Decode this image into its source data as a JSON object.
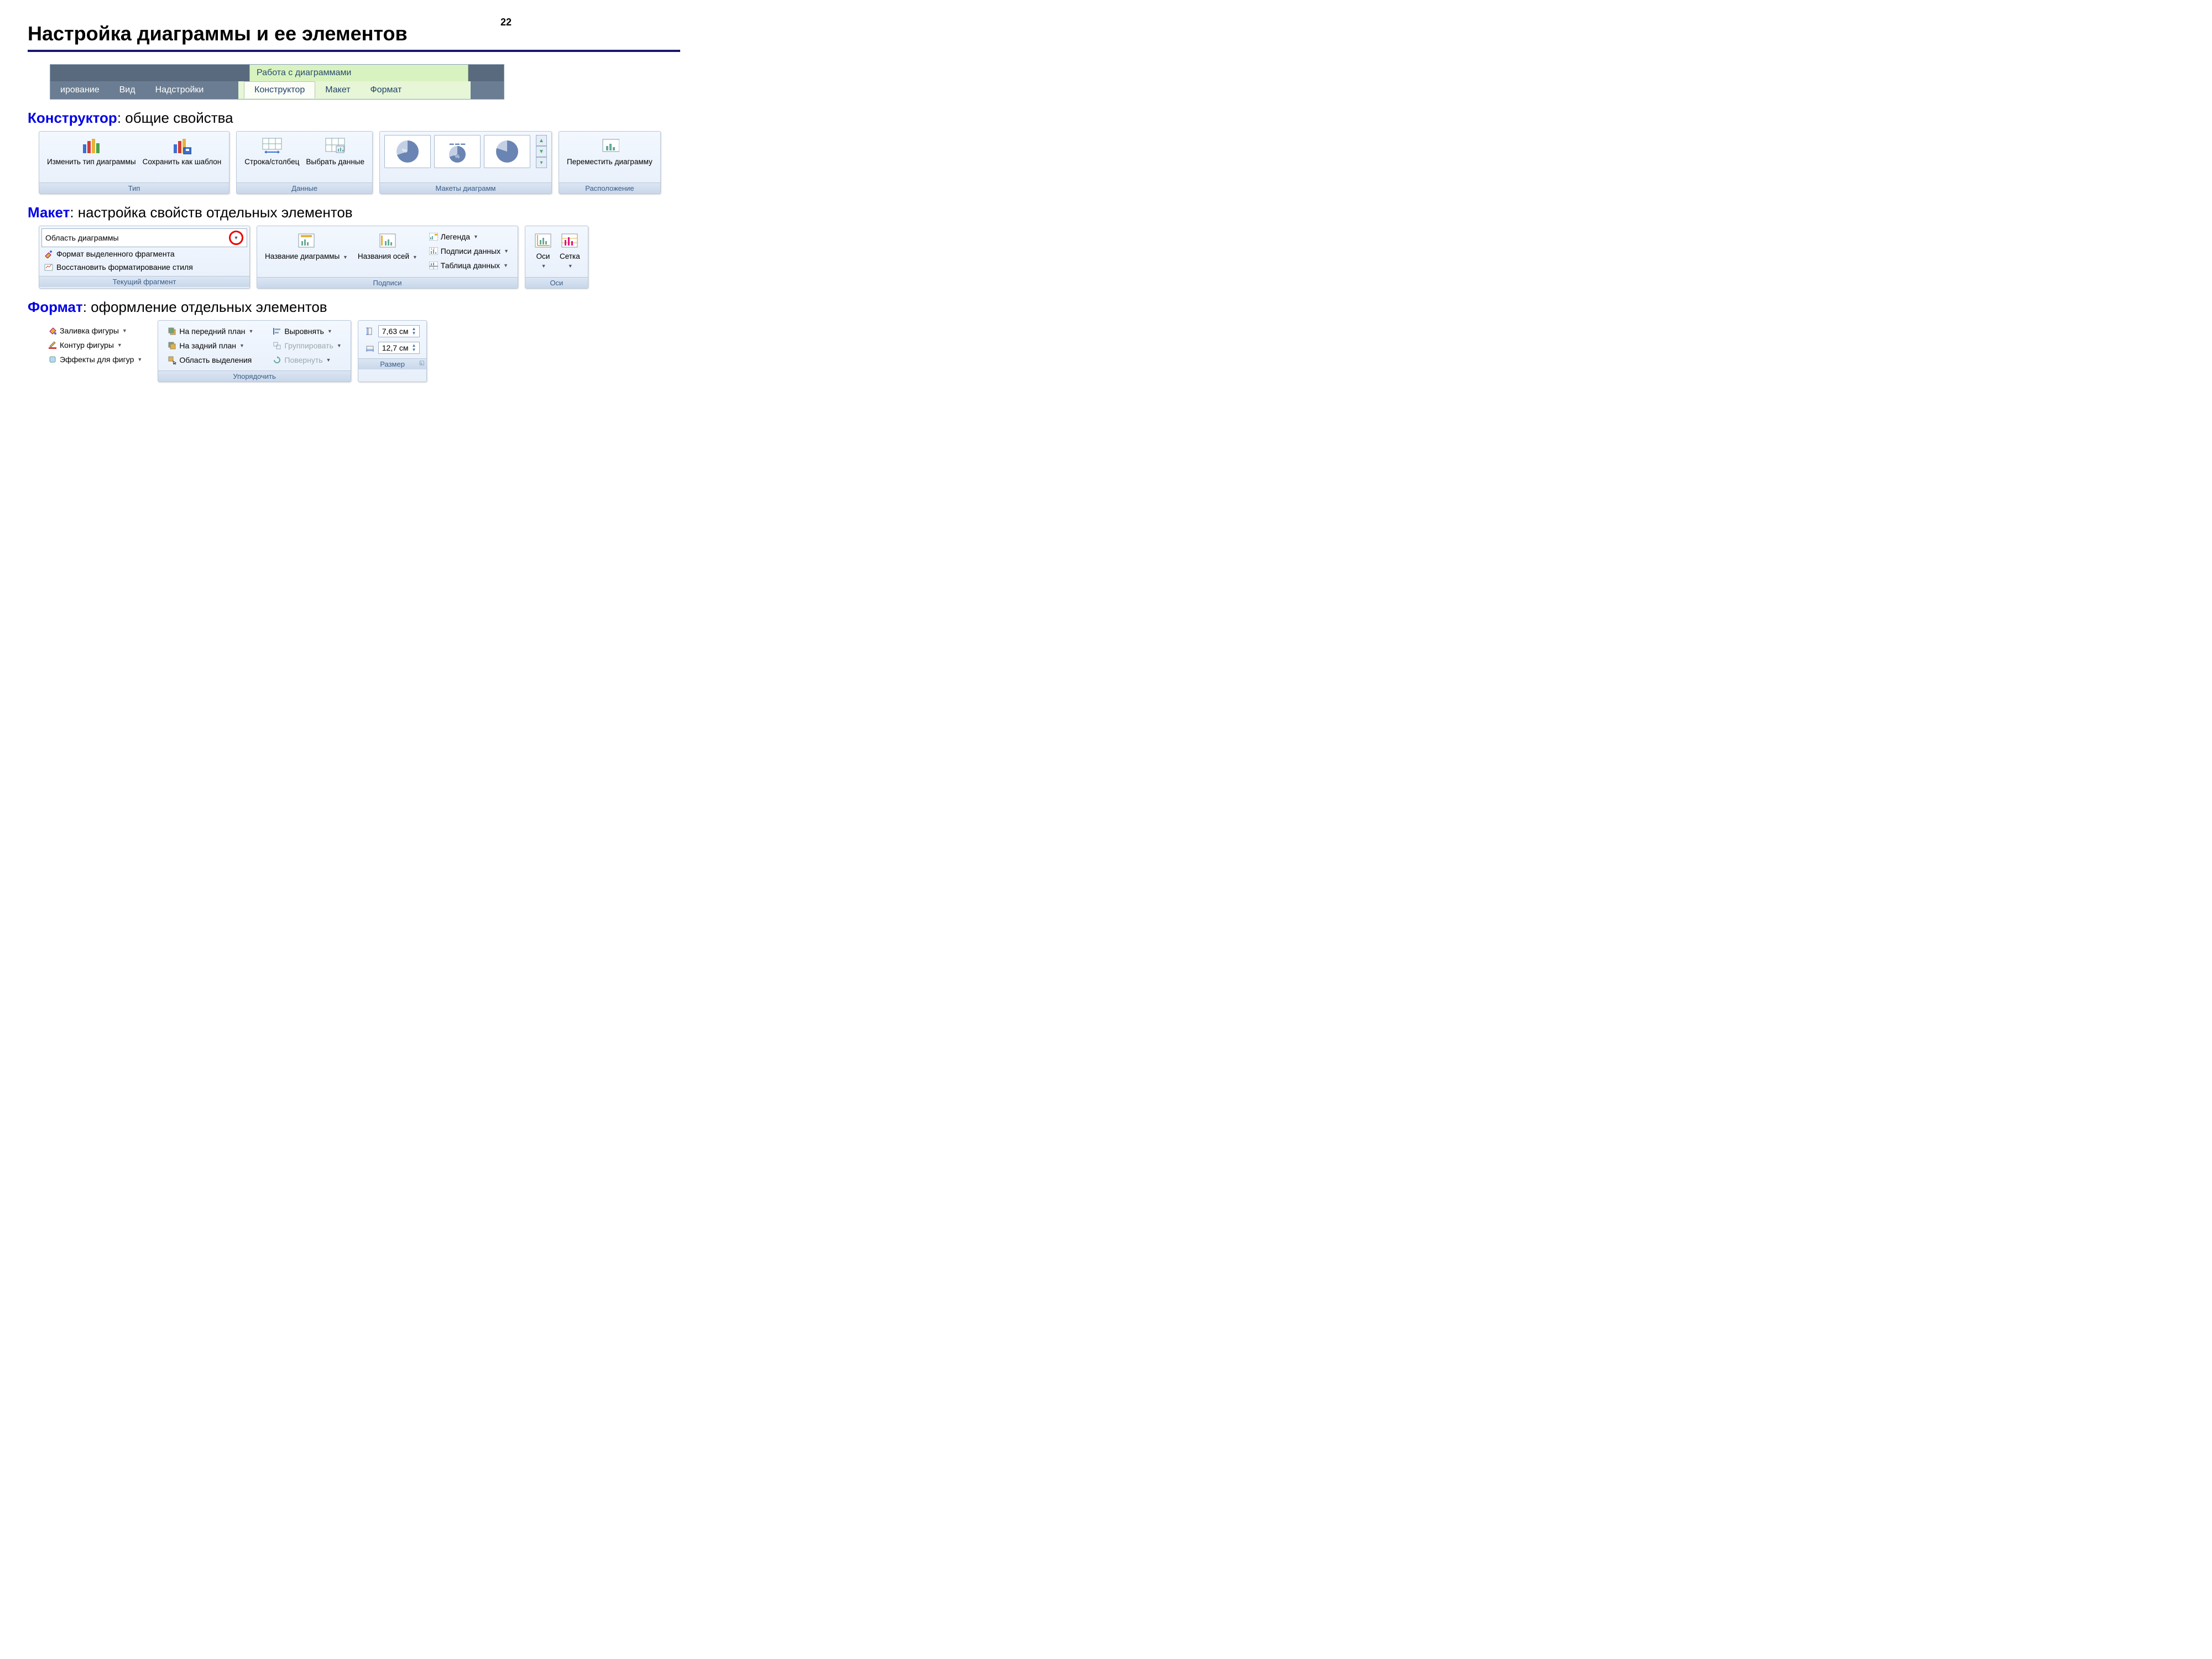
{
  "page_number": "22",
  "title": "Настройка диаграммы и ее элементов",
  "ribbon": {
    "context_title": "Работа с диаграммами",
    "tabs_left": [
      "ирование",
      "Вид",
      "Надстройки"
    ],
    "tabs_context": [
      "Конструктор",
      "Макет",
      "Формат"
    ],
    "active": "Конструктор"
  },
  "sec1": {
    "kw": "Конструктор",
    "rest": ": общие свойства",
    "type_group": {
      "change": "Изменить тип диаграммы",
      "save": "Сохранить как шаблон",
      "footer": "Тип"
    },
    "data_group": {
      "swap": "Строка/столбец",
      "select": "Выбрать данные",
      "footer": "Данные"
    },
    "layouts_footer": "Макеты диаграмм",
    "location": {
      "move": "Переместить диаграмму",
      "footer": "Расположение"
    }
  },
  "sec2": {
    "kw": "Макет",
    "rest": ": настройка свойств отдельных элементов",
    "cur": {
      "area": "Область диаграммы",
      "format_sel": "Формат выделенного фрагмента",
      "reset": "Восстановить форматирование стиля",
      "footer": "Текущий фрагмент"
    },
    "labels": {
      "ch_title": "Название диаграммы",
      "ax_titles": "Названия осей",
      "legend": "Легенда",
      "data_labels": "Подписи данных",
      "data_table": "Таблица данных",
      "footer": "Подписи"
    },
    "axes": {
      "axes": "Оси",
      "grid": "Сетка",
      "footer": "Оси"
    }
  },
  "sec3": {
    "kw": "Формат",
    "rest": ": оформление отдельных элементов",
    "shape": {
      "fill": "Заливка фигуры",
      "outline": "Контур фигуры",
      "effects": "Эффекты для фигур"
    },
    "arrange": {
      "front": "На передний план",
      "back": "На задний план",
      "pane": "Область выделения",
      "align": "Выровнять",
      "group": "Группировать",
      "rotate": "Повернуть",
      "footer": "Упорядочить"
    },
    "size": {
      "h": "7,63 см",
      "w": "12,7 см",
      "footer": "Размер"
    }
  }
}
